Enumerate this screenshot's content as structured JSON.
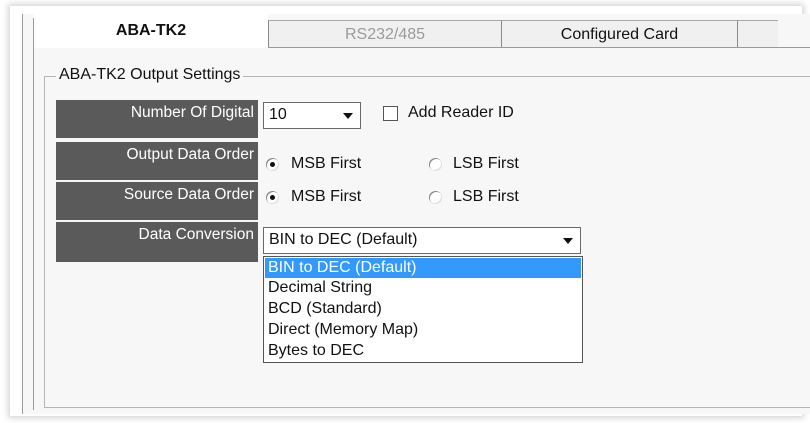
{
  "tabs": [
    {
      "label": "ABA-TK2",
      "state": "active"
    },
    {
      "label": "RS232/485",
      "state": "disabled"
    },
    {
      "label": "Configured Card",
      "state": "inactive"
    },
    {
      "label": "",
      "state": "inactive"
    }
  ],
  "group": {
    "title": "ABA-TK2 Output Settings"
  },
  "fields": {
    "number_of_digital": {
      "label": "Number Of Digital",
      "value": "10"
    },
    "add_reader_id": {
      "label": "Add Reader ID",
      "checked": false
    },
    "output_data_order": {
      "label": "Output Data Order",
      "msb": "MSB First",
      "lsb": "LSB First",
      "selected": "MSB First"
    },
    "source_data_order": {
      "label": "Source Data Order",
      "msb": "MSB First",
      "lsb": "LSB First",
      "selected": "MSB First"
    },
    "data_conversion": {
      "label": "Data Conversion",
      "value": "BIN to DEC (Default)",
      "options": [
        "BIN to DEC (Default)",
        "Decimal String",
        "BCD (Standard)",
        "Direct (Memory Map)",
        "Bytes to DEC"
      ],
      "highlighted": "BIN to DEC (Default)"
    }
  },
  "colors": {
    "label_bg": "#5a5a5a",
    "selection": "#3399ff",
    "window_bg": "#f7f7f7"
  },
  "icons": {
    "dropdown": "chevron-down-icon"
  }
}
